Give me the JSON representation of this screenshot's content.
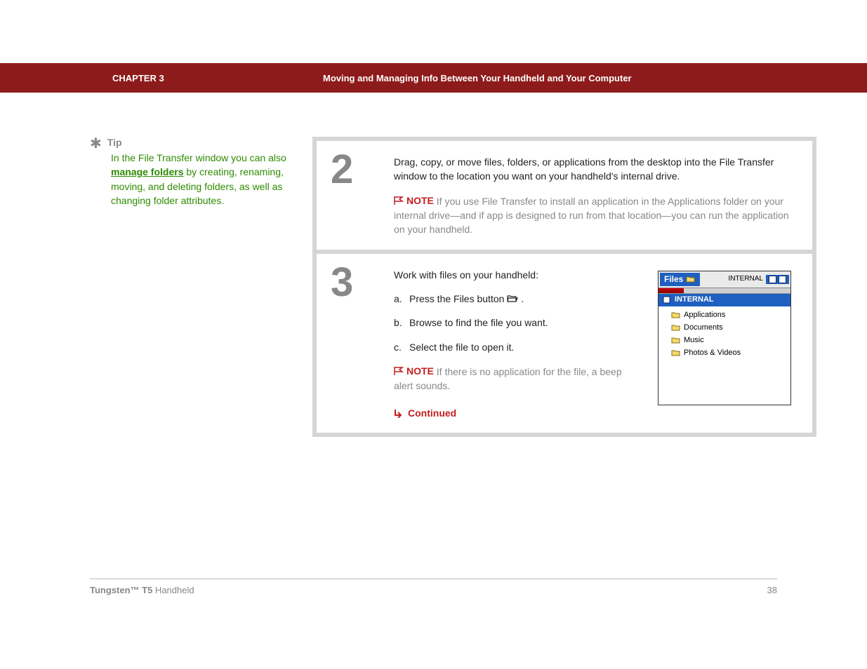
{
  "header": {
    "chapter": "CHAPTER 3",
    "section_title": "Moving and Managing Info Between Your Handheld and Your Computer"
  },
  "tip": {
    "label": "Tip",
    "text_before": "In the File Transfer window you can also ",
    "link": "manage folders",
    "text_after": " by creating, renaming, moving, and deleting folders, as well as changing folder attributes."
  },
  "step2": {
    "number": "2",
    "body": "Drag, copy, or move files, folders, or applications from the desktop into the File Transfer window to the location you want on your handheld's internal drive.",
    "note_label": "NOTE",
    "note_text": "If you use File Transfer to install an application in the Applications folder on your internal drive—and if app is designed to run from that location—you can run the application on your handheld."
  },
  "step3": {
    "number": "3",
    "intro": "Work with files on your handheld:",
    "items": [
      {
        "letter": "a.",
        "text_before": "Press the Files button ",
        "has_icon": true,
        "text_after": "."
      },
      {
        "letter": "b.",
        "text": "Browse to find the file you want."
      },
      {
        "letter": "c.",
        "text": "Select the file to open it."
      }
    ],
    "note_label": "NOTE",
    "note_text": "If there is no application for the file, a beep alert sounds.",
    "continued": "Continued"
  },
  "screenshot": {
    "title": "Files",
    "location": "INTERNAL",
    "selected": "INTERNAL",
    "folders": [
      "Applications",
      "Documents",
      "Music",
      "Photos & Videos"
    ]
  },
  "footer": {
    "product_bold": "Tungsten™ T5",
    "product_rest": " Handheld",
    "page": "38"
  },
  "colors": {
    "header_bg": "#8e1b1b",
    "tip_green": "#2e8b00",
    "note_red": "#c21e1e",
    "step_gray": "#888",
    "device_blue": "#1f5fbf"
  }
}
